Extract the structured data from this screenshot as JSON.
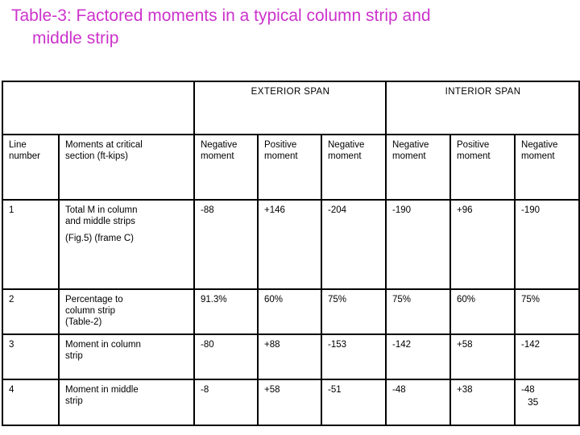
{
  "title": {
    "line1": "Table-3: Factored moments in a typical column strip and",
    "line2": "middle strip",
    "color": "#cc33cc"
  },
  "table": {
    "span_headers": {
      "blank": "",
      "exterior": "EXTERIOR SPAN",
      "interior": "INTERIOR SPAN"
    },
    "column_headers": [
      "Line number",
      "Moments at critical section (ft-kips)",
      "Negative moment",
      "Positive moment",
      "Negative moment",
      "Negative moment",
      "Positive moment",
      "Negative moment"
    ],
    "column_headers_split": {
      "line_number": {
        "l1": "Line",
        "l2": "number"
      },
      "moments": {
        "l1": "Moments at critical",
        "l2": "section (ft-kips)"
      },
      "neg": {
        "l1": "Negative",
        "l2": "moment"
      },
      "pos": {
        "l1": "Positive",
        "l2": "moment"
      }
    },
    "rows": [
      {
        "line": "1",
        "desc_l1": "Total M in column",
        "desc_l2": "and middle strips",
        "desc_l3": "(Fig.5) (frame C)",
        "ext_neg": "-88",
        "ext_pos": "+146",
        "ext_neg2": "-204",
        "int_neg": "-190",
        "int_pos": "+96",
        "int_neg2": "-190"
      },
      {
        "line": "2",
        "desc_l1": "Percentage to",
        "desc_l2": "column strip",
        "desc_l3": "(Table-2)",
        "ext_neg": "91.3%",
        "ext_pos": "60%",
        "ext_neg2": "75%",
        "int_neg": "75%",
        "int_pos": "60%",
        "int_neg2": "75%"
      },
      {
        "line": "3",
        "desc_l1": "Moment in column",
        "desc_l2": "strip",
        "desc_l3": "",
        "ext_neg": "-80",
        "ext_pos": "+88",
        "ext_neg2": "-153",
        "int_neg": "-142",
        "int_pos": "+58",
        "int_neg2": "-142"
      },
      {
        "line": "4",
        "desc_l1": "Moment in middle",
        "desc_l2": "strip",
        "desc_l3": "",
        "ext_neg": "-8",
        "ext_pos": "+58",
        "ext_neg2": "-51",
        "int_neg": "-48",
        "int_pos": "+38",
        "int_neg2": "-48"
      }
    ]
  },
  "page_number": "35"
}
